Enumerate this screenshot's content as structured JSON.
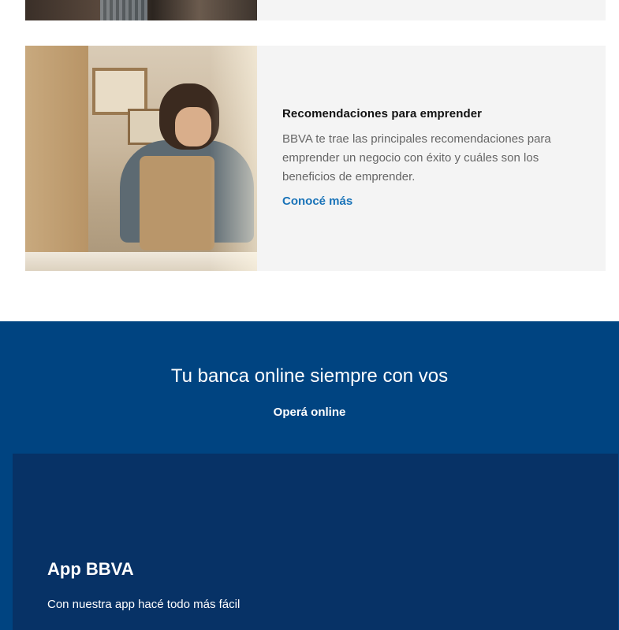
{
  "card_top": {
    "image": "workshop-photo-partial"
  },
  "card": {
    "title": "Recomendaciones para emprender",
    "description": "BBVA te trae las principales recomendaciones para emprender un negocio con éxito y cuáles son los beneficios de emprender.",
    "link_label": "Conocé más"
  },
  "band": {
    "heading": "Tu banca online siempre con vos",
    "cta_label": "Operá online",
    "app": {
      "title": "App BBVA",
      "description": "Con nuestra app hacé todo más fácil"
    }
  },
  "colors": {
    "card_bg": "#f4f4f4",
    "link": "#1973b8",
    "band_bg": "#004481",
    "panel_bg": "#073266"
  }
}
